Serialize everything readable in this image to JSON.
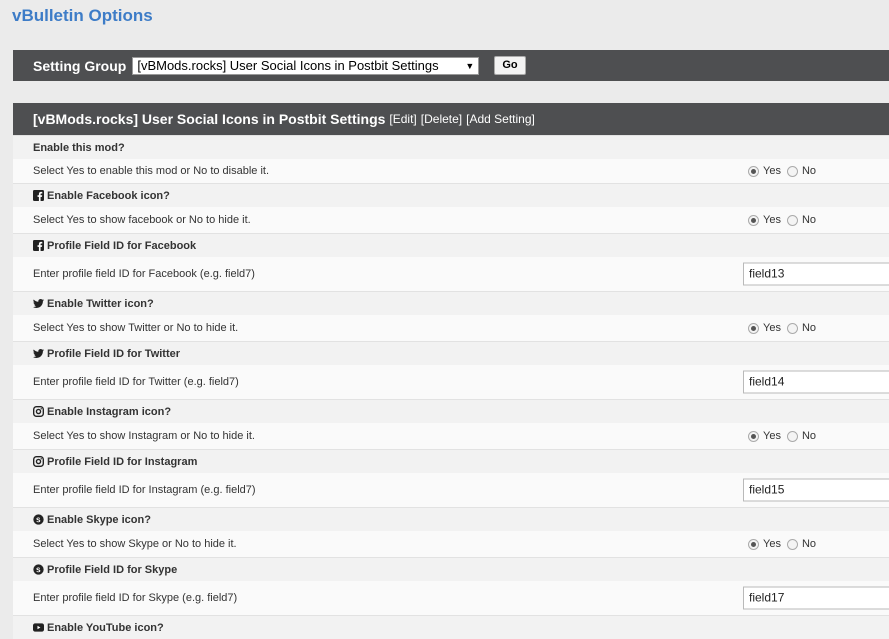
{
  "page_title": "vBulletin Options",
  "setting_group": {
    "label": "Setting Group",
    "selected": "[vBMods.rocks] User Social Icons in Postbit Settings",
    "go_label": "Go"
  },
  "settings_header": {
    "title": "[vBMods.rocks] User Social Icons in Postbit Settings",
    "edit": "[Edit]",
    "delete": "[Delete]",
    "add": "[Add Setting]"
  },
  "radio": {
    "yes": "Yes",
    "no": "No"
  },
  "settings": [
    {
      "title": "Enable this mod?",
      "desc": "Select Yes to enable this mod or No to disable it.",
      "icon": ""
    },
    {
      "title": "Enable Facebook icon?",
      "desc": "Select Yes to show facebook or No to hide it.",
      "icon": "facebook-icon"
    },
    {
      "title": "Profile Field ID for Facebook",
      "desc": "Enter profile field ID for Facebook (e.g. field7)",
      "value": "field13",
      "icon": "facebook-icon"
    },
    {
      "title": "Enable Twitter icon?",
      "desc": "Select Yes to show Twitter or No to hide it.",
      "icon": "twitter-icon"
    },
    {
      "title": "Profile Field ID for Twitter",
      "desc": "Enter profile field ID for Twitter (e.g. field7)",
      "value": "field14",
      "icon": "twitter-icon"
    },
    {
      "title": "Enable Instagram icon?",
      "desc": "Select Yes to show Instagram or No to hide it.",
      "icon": "instagram-icon"
    },
    {
      "title": "Profile Field ID for Instagram",
      "desc": "Enter profile field ID for Instagram (e.g. field7)",
      "value": "field15",
      "icon": "instagram-icon"
    },
    {
      "title": "Enable Skype icon?",
      "desc": "Select Yes to show Skype or No to hide it.",
      "icon": "skype-icon"
    },
    {
      "title": "Profile Field ID for Skype",
      "desc": "Enter profile field ID for Skype (e.g. field7)",
      "value": "field17",
      "icon": "skype-icon"
    },
    {
      "title": "Enable YouTube icon?",
      "icon": "youtube-icon"
    }
  ]
}
